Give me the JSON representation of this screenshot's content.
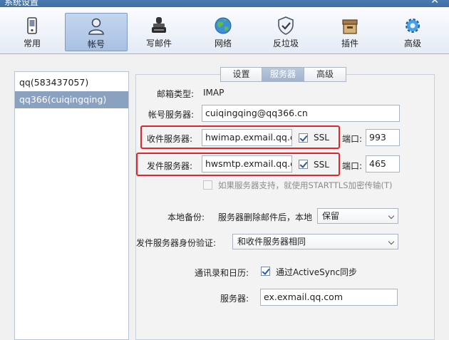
{
  "window": {
    "title": "系统设置",
    "close_glyph": "✕"
  },
  "toolbar": {
    "items": [
      {
        "label": "常用",
        "icon": "phone-icon"
      },
      {
        "label": "帐号",
        "icon": "user-icon",
        "active": true
      },
      {
        "label": "写邮件",
        "icon": "stamp-icon"
      },
      {
        "label": "网络",
        "icon": "globe-icon"
      },
      {
        "label": "反垃圾",
        "icon": "shield-icon"
      },
      {
        "label": "插件",
        "icon": "box-icon"
      },
      {
        "label": "高级",
        "icon": "gear-icon"
      }
    ]
  },
  "accounts": [
    {
      "label": "qq(583437057)",
      "selected": false
    },
    {
      "label": "qq366(cuiqingqing)",
      "selected": true
    }
  ],
  "tabs": [
    {
      "label": "设置"
    },
    {
      "label": "服务器",
      "active": true
    },
    {
      "label": "高级"
    }
  ],
  "form": {
    "mail_type_label": "邮箱类型:",
    "mail_type_value": "IMAP",
    "account_server_label": "帐号服务器:",
    "account_server_value": "cuiqingqing@qq366.cn",
    "incoming_label": "收件服务器:",
    "incoming_value": "hwimap.exmail.qq.cc",
    "incoming_ssl_label": "SSL",
    "incoming_port_label": "端口:",
    "incoming_port_value": "993",
    "outgoing_label": "发件服务器:",
    "outgoing_value": "hwsmtp.exmail.qq.cc",
    "outgoing_ssl_label": "SSL",
    "outgoing_port_label": "端口:",
    "outgoing_port_value": "465",
    "starttls_label": "如果服务器支持，就使用STARTTLS加密传输(T)",
    "backup_label": "本地备份:",
    "backup_desc": "服务器删除邮件后，本地",
    "backup_value": "保留",
    "auth_label": "发件服务器身份验证:",
    "auth_value": "和收件服务器相同",
    "contacts_label": "通讯录和日历:",
    "activesync_label": "通过ActiveSync同步",
    "sync_server_label": "服务器:",
    "sync_server_value": "ex.exmail.qq.com"
  },
  "colors": {
    "highlight": "#e3242b",
    "selected_account": "#8aa2c0",
    "active_tab": "#a9bcd3"
  }
}
